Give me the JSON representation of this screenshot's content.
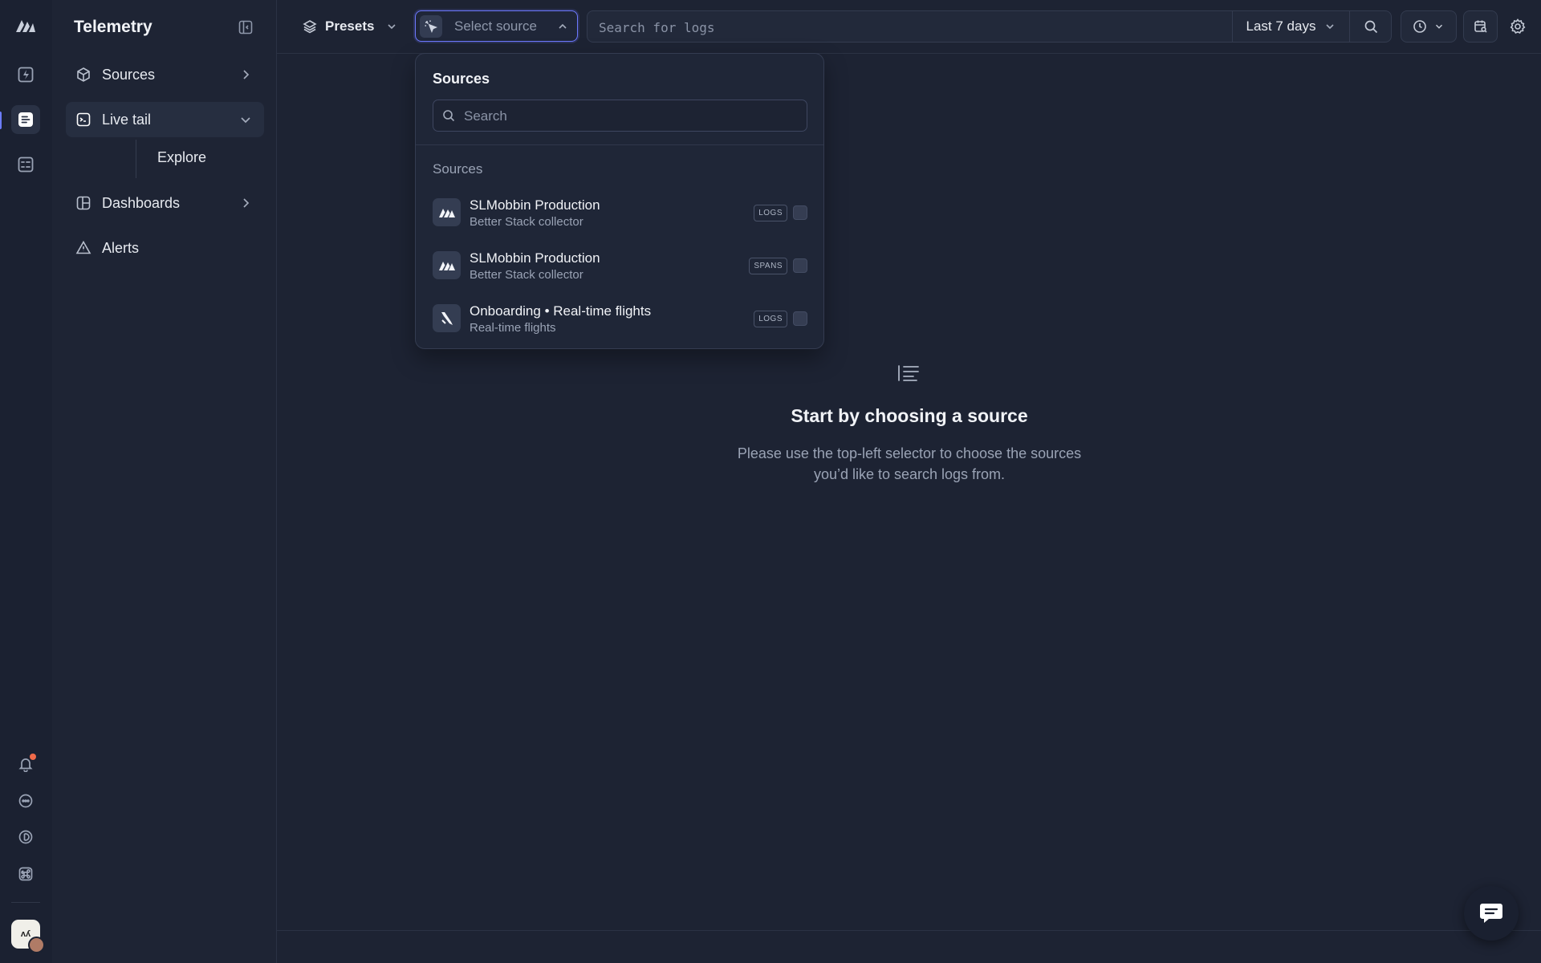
{
  "app": {
    "title": "Telemetry"
  },
  "rail": {
    "items": [
      {
        "icon": "lightning-icon",
        "active": false
      },
      {
        "icon": "logs-icon",
        "active": true
      },
      {
        "icon": "checklist-icon",
        "active": false
      }
    ],
    "bottom_items": [
      "bell-icon",
      "chat-bubble-icon",
      "billing-icon",
      "command-icon"
    ],
    "avatar_initials": "ʌʎ"
  },
  "sidebar": {
    "items": [
      {
        "label": "Sources",
        "icon": "cube-icon",
        "chevron": "right"
      },
      {
        "label": "Live tail",
        "icon": "terminal-icon",
        "chevron": "down",
        "active": true
      },
      {
        "label": "Dashboards",
        "icon": "dashboard-icon",
        "chevron": "right"
      },
      {
        "label": "Alerts",
        "icon": "warning-icon"
      }
    ],
    "sub_items": [
      {
        "label": "Explore"
      }
    ]
  },
  "toolbar": {
    "presets_label": "Presets",
    "select_source_placeholder": "Select source",
    "search_placeholder": "Search for logs",
    "time_range": "Last 7 days"
  },
  "dropdown": {
    "title": "Sources",
    "search_placeholder": "Search",
    "section_label": "Sources",
    "sources": [
      {
        "name": "SLMobbin Production",
        "subtitle": "Better Stack collector",
        "badge": "LOGS",
        "logo": "betterstack-logo-icon"
      },
      {
        "name": "SLMobbin Production",
        "subtitle": "Better Stack collector",
        "badge": "SPANS",
        "logo": "betterstack-logo-icon"
      },
      {
        "name": "Onboarding • Real-time flights",
        "subtitle": "Real-time flights",
        "badge": "LOGS",
        "logo": "airplane-logo-icon"
      }
    ]
  },
  "empty_state": {
    "title": "Start by choosing a source",
    "description": "Please use the top-left selector to choose the sources you’d like to search logs from."
  },
  "colors": {
    "background": "#1d2333",
    "accent": "#6d78ff",
    "notification": "#f06a4a"
  }
}
